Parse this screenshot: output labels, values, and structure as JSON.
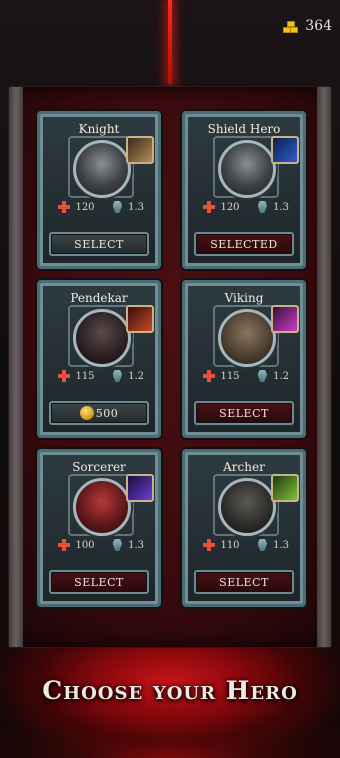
{
  "currency": {
    "amount": "364",
    "icon": "gold-bars-icon"
  },
  "heroes": [
    {
      "name": "Knight",
      "hp": "120",
      "speed": "1.3",
      "action": "SELECT",
      "skill_color": "#b58d5a",
      "portrait_icon": "knight-portrait-icon",
      "skill_icon": "sword-slash-icon"
    },
    {
      "name": "Shield Hero",
      "hp": "120",
      "speed": "1.3",
      "action": "SELECTED",
      "skill_color": "#2c5ec9",
      "portrait_icon": "shield-hero-portrait-icon",
      "skill_icon": "shield-icon"
    },
    {
      "name": "Pendekar",
      "hp": "115",
      "speed": "1.2",
      "action": "500",
      "price_icon": "coin-icon",
      "skill_color": "#c4482a",
      "portrait_icon": "pendekar-portrait-icon",
      "skill_icon": "claw-slash-icon"
    },
    {
      "name": "Viking",
      "hp": "115",
      "speed": "1.2",
      "action": "SELECT",
      "skill_color": "#c83fc4",
      "portrait_icon": "viking-portrait-icon",
      "skill_icon": "axe-swing-icon"
    },
    {
      "name": "Sorcerer",
      "hp": "100",
      "speed": "1.3",
      "action": "SELECT",
      "skill_color": "#6b3fd1",
      "portrait_icon": "sorcerer-portrait-icon",
      "skill_icon": "magic-bolt-icon"
    },
    {
      "name": "Archer",
      "hp": "110",
      "speed": "1.3",
      "action": "SELECT",
      "skill_color": "#7fc33a",
      "portrait_icon": "archer-portrait-icon",
      "skill_icon": "arrow-volley-icon"
    }
  ],
  "footer_title": "Choose your Hero"
}
